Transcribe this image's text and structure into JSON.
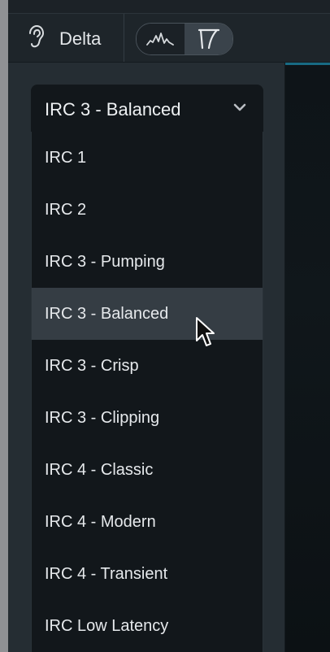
{
  "toolbar": {
    "delta_label": "Delta",
    "delta_icon": "ear-icon",
    "view_toggle": {
      "options": [
        "waveform-icon",
        "filter-curve-icon"
      ],
      "active_index": 1
    }
  },
  "dropdown": {
    "selected_value": "IRC 3 - Balanced",
    "chevron_icon": "chevron-down-icon",
    "options": [
      "IRC 1",
      "IRC 2",
      "IRC 3 - Pumping",
      "IRC 3 - Balanced",
      "IRC 3 - Crisp",
      "IRC 3 - Clipping",
      "IRC 4 - Classic",
      "IRC 4 - Modern",
      "IRC 4 - Transient",
      "IRC Low Latency"
    ],
    "hovered_index": 3
  },
  "colors": {
    "panel": "#252d33",
    "dropdown_bg": "#12171b",
    "highlight": "#353d44",
    "accent": "#1d8fb0",
    "text": "#e6e9ec"
  }
}
